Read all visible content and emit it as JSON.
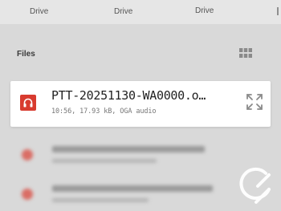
{
  "tabs": [
    "Drive",
    "Drive",
    "Drive"
  ],
  "section_title": "Files",
  "file": {
    "name": "PTT-20251130-WA0000.o…",
    "meta": "10:56, 17.93 kB, OGA audio"
  },
  "icons": {
    "view_toggle": "grid-view-icon",
    "file_type": "audio-file-icon",
    "expand": "expand-icon",
    "watermark": "logo-watermark"
  },
  "colors": {
    "accent": "#d83b2f",
    "card_bg": "#ffffff",
    "overlay_bg": "#d9d9d9"
  }
}
